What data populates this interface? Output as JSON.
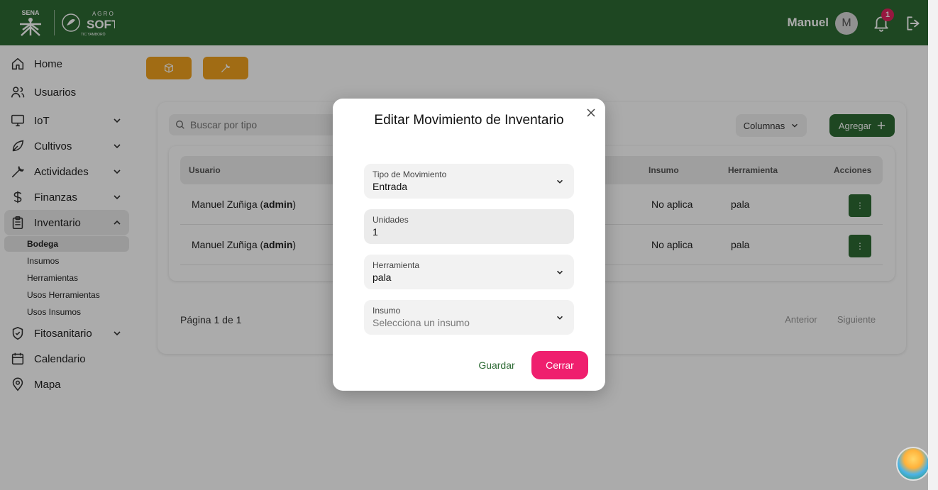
{
  "header": {
    "logo_left": "SENA",
    "logo_right": "AGRO SOFT",
    "logo_right_sub": "TIC YAMBORÓ",
    "user_name": "Manuel",
    "avatar_initial": "M",
    "notifications_count": "1",
    "brand_color": "#2d6a34"
  },
  "sidebar": {
    "items": [
      {
        "label": "Home",
        "icon": "home-icon"
      },
      {
        "label": "Usuarios",
        "icon": "users-icon"
      },
      {
        "label": "IoT",
        "icon": "monitor-icon",
        "expandable": true
      },
      {
        "label": "Cultivos",
        "icon": "leaf-icon",
        "expandable": true
      },
      {
        "label": "Actividades",
        "icon": "wrench-icon",
        "expandable": true
      },
      {
        "label": "Finanzas",
        "icon": "dollar-icon",
        "expandable": true
      },
      {
        "label": "Inventario",
        "icon": "clipboard-icon",
        "expandable": true,
        "expanded": true
      },
      {
        "label": "Fitosanitario",
        "icon": "shield-icon",
        "expandable": true
      },
      {
        "label": "Calendario",
        "icon": "calendar-icon"
      },
      {
        "label": "Mapa",
        "icon": "map-pin-icon"
      }
    ],
    "inventario_sub": [
      "Bodega",
      "Insumos",
      "Herramientas",
      "Usos Herramientas",
      "Usos Insumos"
    ],
    "active_sub": "Bodega"
  },
  "main": {
    "top_buttons": [
      {
        "icon": "box-icon"
      },
      {
        "icon": "wrench-icon"
      }
    ],
    "search": {
      "placeholder": "Buscar por tipo"
    },
    "columns_label": "Columnas",
    "add_label": "Agregar",
    "table": {
      "headers": [
        "Usuario",
        "Insumo",
        "Herramienta",
        "Acciones"
      ],
      "rows": [
        {
          "usuario_name": "Manuel Zuñiga (",
          "usuario_role": "admin",
          "usuario_close": ")",
          "insumo": "No aplica",
          "herramienta": "pala"
        },
        {
          "usuario_name": "Manuel Zuñiga (",
          "usuario_role": "admin",
          "usuario_close": ")",
          "insumo": "No aplica",
          "herramienta": "pala"
        }
      ]
    },
    "pagination": {
      "text": "Página 1 de 1",
      "prev": "Anterior",
      "next": "Siguiente"
    }
  },
  "modal": {
    "title": "Editar Movimiento de Inventario",
    "fields": [
      {
        "label": "Tipo de Movimiento",
        "value": "Entrada",
        "kind": "select"
      },
      {
        "label": "Unidades",
        "value": "1",
        "kind": "input"
      },
      {
        "label": "Herramienta",
        "value": "pala",
        "kind": "select"
      },
      {
        "label": "Insumo",
        "placeholder": "Selecciona un insumo",
        "kind": "select"
      }
    ],
    "save_label": "Guardar",
    "close_label": "Cerrar",
    "close_color": "#ef1f6e"
  }
}
